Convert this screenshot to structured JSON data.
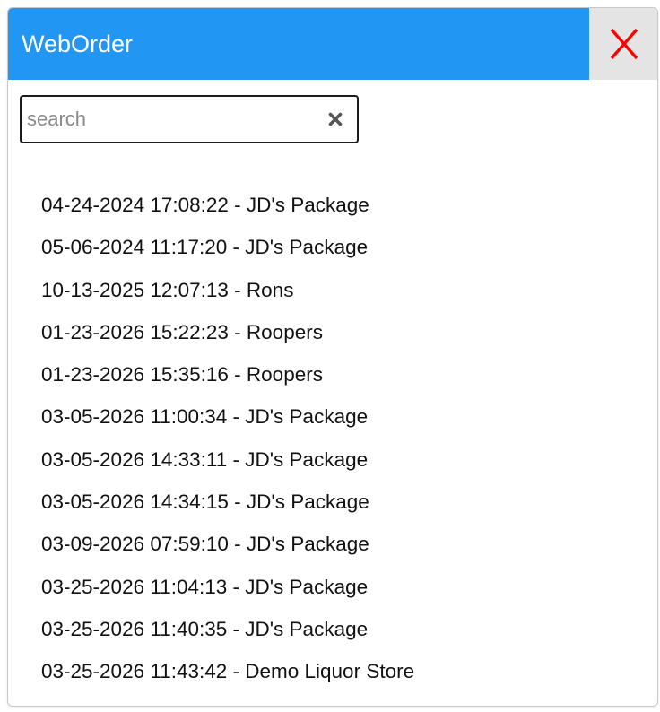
{
  "window": {
    "title": "WebOrder",
    "close_label": "X",
    "colors": {
      "titlebar": "#2196f3",
      "close_background": "#e4e4e4",
      "close_glyph": "#ff0000"
    }
  },
  "search": {
    "placeholder": "search",
    "value": "",
    "clear_icon": "clear-x-icon"
  },
  "orders": [
    "04-24-2024 17:08:22 - JD's Package",
    "05-06-2024 11:17:20 - JD's Package",
    "10-13-2025 12:07:13 - Rons",
    "01-23-2026 15:22:23 - Roopers",
    "01-23-2026 15:35:16 - Roopers",
    "03-05-2026 11:00:34 - JD's Package",
    "03-05-2026 14:33:11 - JD's Package",
    "03-05-2026 14:34:15 - JD's Package",
    "03-09-2026 07:59:10 - JD's Package",
    "03-25-2026 11:04:13 - JD's Package",
    "03-25-2026 11:40:35 - JD's Package",
    "03-25-2026 11:43:42 - Demo Liquor Store"
  ]
}
